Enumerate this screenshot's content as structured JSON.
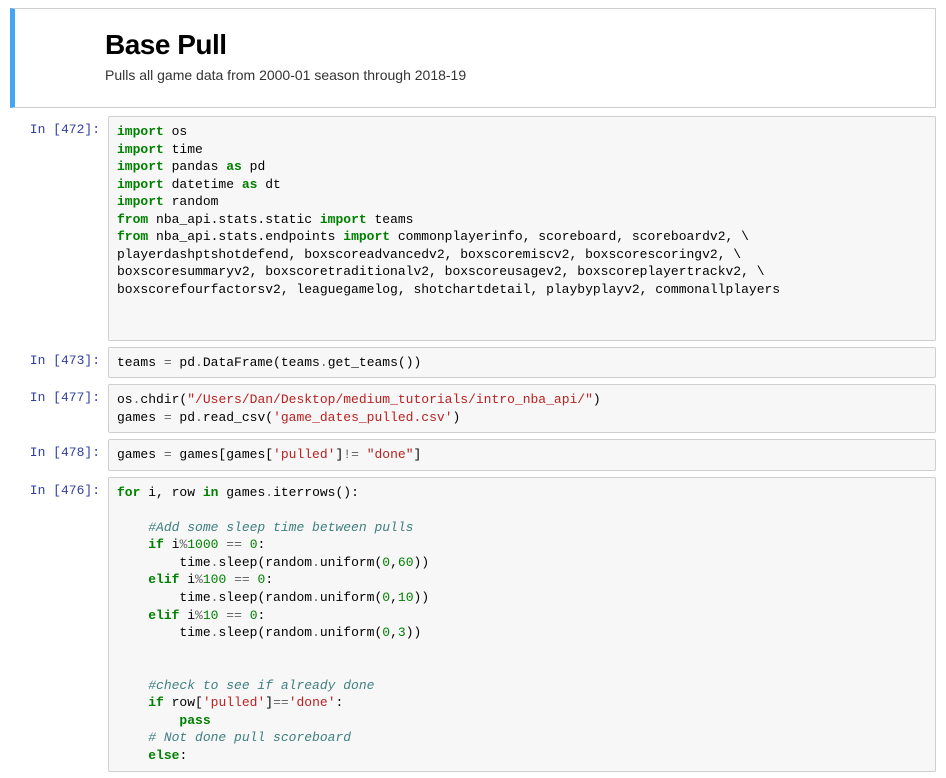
{
  "markdown": {
    "title": "Base Pull",
    "subtitle": "Pulls all game data from 2000-01 season through 2018-19"
  },
  "cells": [
    {
      "prompt": "In [472]:",
      "tokens": [
        [
          "kw-green",
          "import"
        ],
        [
          "t",
          " os\n"
        ],
        [
          "kw-green",
          "import"
        ],
        [
          "t",
          " time\n"
        ],
        [
          "kw-green",
          "import"
        ],
        [
          "t",
          " pandas "
        ],
        [
          "kw-green",
          "as"
        ],
        [
          "t",
          " pd\n"
        ],
        [
          "kw-green",
          "import"
        ],
        [
          "t",
          " datetime "
        ],
        [
          "kw-green",
          "as"
        ],
        [
          "t",
          " dt\n"
        ],
        [
          "kw-green",
          "import"
        ],
        [
          "t",
          " random\n"
        ],
        [
          "kw-green",
          "from"
        ],
        [
          "t",
          " nba_api.stats.static "
        ],
        [
          "kw-green",
          "import"
        ],
        [
          "t",
          " teams\n"
        ],
        [
          "kw-green",
          "from"
        ],
        [
          "t",
          " nba_api.stats.endpoints "
        ],
        [
          "kw-green",
          "import"
        ],
        [
          "t",
          " commonplayerinfo, scoreboard, scoreboardv2, \\\n"
        ],
        [
          "t",
          "playerdashptshotdefend, boxscoreadvancedv2, boxscoremiscv2, boxscorescoringv2, \\\n"
        ],
        [
          "t",
          "boxscoresummaryv2, boxscoretraditionalv2, boxscoreusagev2, boxscoreplayertrackv2, \\\n"
        ],
        [
          "t",
          "boxscorefourfactorsv2, leaguegamelog, shotchartdetail, playbyplayv2, commonallplayers\n"
        ],
        [
          "t",
          "\n"
        ],
        [
          "t",
          "\n"
        ]
      ]
    },
    {
      "prompt": "In [473]:",
      "tokens": [
        [
          "t",
          "teams "
        ],
        [
          "op",
          "="
        ],
        [
          "t",
          " pd"
        ],
        [
          "op",
          "."
        ],
        [
          "t",
          "DataFrame(teams"
        ],
        [
          "op",
          "."
        ],
        [
          "t",
          "get_teams())"
        ]
      ]
    },
    {
      "prompt": "In [477]:",
      "tokens": [
        [
          "t",
          "os"
        ],
        [
          "op",
          "."
        ],
        [
          "t",
          "chdir("
        ],
        [
          "str-red",
          "\"/Users/Dan/Desktop/medium_tutorials/intro_nba_api/\""
        ],
        [
          "t",
          ")\n"
        ],
        [
          "t",
          "games "
        ],
        [
          "op",
          "="
        ],
        [
          "t",
          " pd"
        ],
        [
          "op",
          "."
        ],
        [
          "t",
          "read_csv("
        ],
        [
          "str-red",
          "'game_dates_pulled.csv'"
        ],
        [
          "t",
          ")"
        ]
      ]
    },
    {
      "prompt": "In [478]:",
      "tokens": [
        [
          "t",
          "games "
        ],
        [
          "op",
          "="
        ],
        [
          "t",
          " games[games["
        ],
        [
          "str-red",
          "'pulled'"
        ],
        [
          "t",
          "]"
        ],
        [
          "op",
          "!="
        ],
        [
          "t",
          " "
        ],
        [
          "str-red",
          "\"done\""
        ],
        [
          "t",
          "]"
        ]
      ]
    },
    {
      "prompt": "In [476]:",
      "tokens": [
        [
          "kw-green",
          "for"
        ],
        [
          "t",
          " i, row "
        ],
        [
          "kw-green",
          "in"
        ],
        [
          "t",
          " games"
        ],
        [
          "op",
          "."
        ],
        [
          "t",
          "iterrows():\n"
        ],
        [
          "t",
          "    \n"
        ],
        [
          "t",
          "    "
        ],
        [
          "comment",
          "#Add some sleep time between pulls"
        ],
        [
          "t",
          "\n"
        ],
        [
          "t",
          "    "
        ],
        [
          "kw-green",
          "if"
        ],
        [
          "t",
          " i"
        ],
        [
          "op",
          "%"
        ],
        [
          "num",
          "1000"
        ],
        [
          "t",
          " "
        ],
        [
          "op",
          "=="
        ],
        [
          "t",
          " "
        ],
        [
          "num",
          "0"
        ],
        [
          "t",
          ":\n"
        ],
        [
          "t",
          "        time"
        ],
        [
          "op",
          "."
        ],
        [
          "t",
          "sleep(random"
        ],
        [
          "op",
          "."
        ],
        [
          "t",
          "uniform("
        ],
        [
          "num",
          "0"
        ],
        [
          "t",
          ","
        ],
        [
          "num",
          "60"
        ],
        [
          "t",
          "))\n"
        ],
        [
          "t",
          "    "
        ],
        [
          "kw-green",
          "elif"
        ],
        [
          "t",
          " i"
        ],
        [
          "op",
          "%"
        ],
        [
          "num",
          "100"
        ],
        [
          "t",
          " "
        ],
        [
          "op",
          "=="
        ],
        [
          "t",
          " "
        ],
        [
          "num",
          "0"
        ],
        [
          "t",
          ":\n"
        ],
        [
          "t",
          "        time"
        ],
        [
          "op",
          "."
        ],
        [
          "t",
          "sleep(random"
        ],
        [
          "op",
          "."
        ],
        [
          "t",
          "uniform("
        ],
        [
          "num",
          "0"
        ],
        [
          "t",
          ","
        ],
        [
          "num",
          "10"
        ],
        [
          "t",
          "))\n"
        ],
        [
          "t",
          "    "
        ],
        [
          "kw-green",
          "elif"
        ],
        [
          "t",
          " i"
        ],
        [
          "op",
          "%"
        ],
        [
          "num",
          "10"
        ],
        [
          "t",
          " "
        ],
        [
          "op",
          "=="
        ],
        [
          "t",
          " "
        ],
        [
          "num",
          "0"
        ],
        [
          "t",
          ":\n"
        ],
        [
          "t",
          "        time"
        ],
        [
          "op",
          "."
        ],
        [
          "t",
          "sleep(random"
        ],
        [
          "op",
          "."
        ],
        [
          "t",
          "uniform("
        ],
        [
          "num",
          "0"
        ],
        [
          "t",
          ","
        ],
        [
          "num",
          "3"
        ],
        [
          "t",
          "))\n"
        ],
        [
          "t",
          "\n"
        ],
        [
          "t",
          "\n"
        ],
        [
          "t",
          "    "
        ],
        [
          "comment",
          "#check to see if already done"
        ],
        [
          "t",
          "\n"
        ],
        [
          "t",
          "    "
        ],
        [
          "kw-green",
          "if"
        ],
        [
          "t",
          " row["
        ],
        [
          "str-red",
          "'pulled'"
        ],
        [
          "t",
          "]"
        ],
        [
          "op",
          "=="
        ],
        [
          "str-red",
          "'done'"
        ],
        [
          "t",
          ":\n"
        ],
        [
          "t",
          "        "
        ],
        [
          "kw-green",
          "pass"
        ],
        [
          "t",
          "\n"
        ],
        [
          "t",
          "    "
        ],
        [
          "comment",
          "# Not done pull scoreboard"
        ],
        [
          "t",
          "\n"
        ],
        [
          "t",
          "    "
        ],
        [
          "kw-green",
          "else"
        ],
        [
          "t",
          ":"
        ]
      ]
    }
  ]
}
